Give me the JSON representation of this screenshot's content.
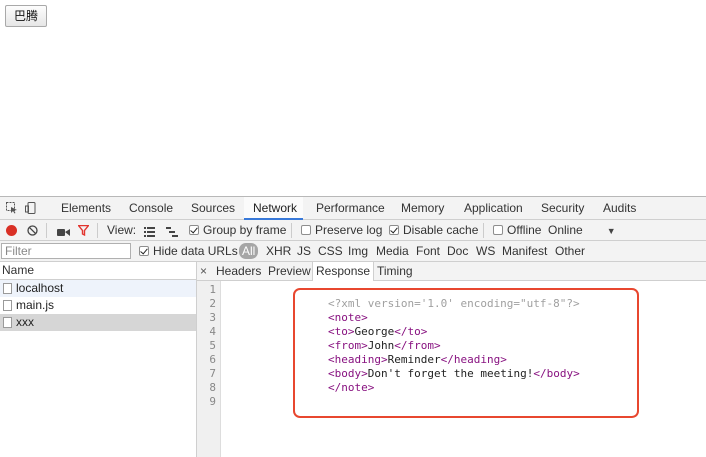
{
  "page": {
    "button_label": "巴腾"
  },
  "devtools": {
    "tabs": [
      "Elements",
      "Console",
      "Sources",
      "Network",
      "Performance",
      "Memory",
      "Application",
      "Security",
      "Audits"
    ],
    "active_tab": "Network",
    "toolbar": {
      "view_label": "View:",
      "group_by_frame": {
        "label": "Group by frame",
        "checked": true
      },
      "preserve_log": {
        "label": "Preserve log",
        "checked": false
      },
      "disable_cache": {
        "label": "Disable cache",
        "checked": true
      },
      "offline": {
        "label": "Offline",
        "checked": false
      },
      "throttle": "Online"
    },
    "filter": {
      "placeholder": "Filter",
      "hide_data_urls": {
        "label": "Hide data URLs",
        "checked": true
      },
      "types": [
        "All",
        "XHR",
        "JS",
        "CSS",
        "Img",
        "Media",
        "Font",
        "Doc",
        "WS",
        "Manifest",
        "Other"
      ],
      "active_type": "All"
    },
    "requests": {
      "header": "Name",
      "items": [
        "localhost",
        "main.js",
        "xxx"
      ],
      "selected": "xxx"
    },
    "detail": {
      "close": "×",
      "tabs": [
        "Headers",
        "Preview",
        "Response",
        "Timing"
      ],
      "active_tab": "Response",
      "line_numbers": [
        "1",
        "2",
        "3",
        "4",
        "5",
        "6",
        "7",
        "8",
        "9"
      ],
      "response": {
        "decl": "<?xml version='1.0' encoding=\"utf-8\"?>",
        "note_open": "<note>",
        "to_open": "<to>",
        "to_text": "George",
        "to_close": "</to>",
        "from_open": "<from>",
        "from_text": "John",
        "from_close": "</from>",
        "heading_open": "<heading>",
        "heading_text": "Reminder",
        "heading_close": "</heading>",
        "body_open": "<body>",
        "body_text": "Don't forget the meeting!",
        "body_close": "</body>",
        "note_close": "</note>"
      }
    },
    "colors": {
      "accent": "#3879d9",
      "record": "#d93025",
      "filter_icon": "#e2352f",
      "annotation": "#e8472f",
      "xml_tag": "#881280"
    }
  }
}
